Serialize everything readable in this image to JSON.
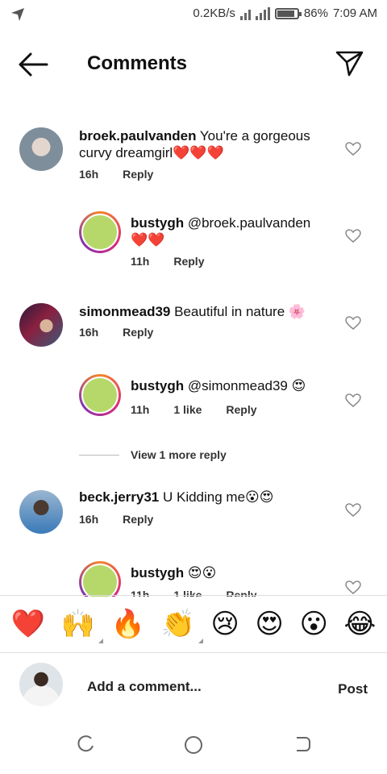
{
  "status": {
    "speed": "0.2KB/s",
    "battery": "86%",
    "battery_level": 0.86,
    "time": "7:09 AM"
  },
  "header": {
    "title": "Comments"
  },
  "comments": [
    {
      "user": "broek.paulvanden",
      "text": "You're a gorgeous curvy dreamgirl❤️❤️❤️",
      "time": "16h",
      "likes": "",
      "reply": "Reply"
    },
    {
      "user": "bustygh",
      "text": "@broek.paulvanden ❤️❤️",
      "time": "11h",
      "likes": "",
      "reply": "Reply"
    },
    {
      "user": "simonmead39",
      "text": "Beautiful in nature 🌸",
      "time": "16h",
      "likes": "",
      "reply": "Reply"
    },
    {
      "user": "bustygh",
      "text": "@simonmead39 😍",
      "time": "11h",
      "likes": "1 like",
      "reply": "Reply"
    },
    {
      "user": "beck.jerry31",
      "text": "U Kidding me😮😍",
      "time": "16h",
      "likes": "",
      "reply": "Reply"
    },
    {
      "user": "bustygh",
      "text": "😍😮",
      "time": "11h",
      "likes": "1 like",
      "reply": "Reply"
    }
  ],
  "view_more": "View 1 more reply",
  "emojis": [
    "❤️",
    "🙌",
    "🔥",
    "👏",
    "😢",
    "😍",
    "😮",
    "😂"
  ],
  "composer": {
    "placeholder": "Add a comment...",
    "post": "Post"
  },
  "colors": {
    "accent_ring": "#dd2a7b",
    "text": "#111111"
  },
  "icons": {
    "back": "back-arrow-icon",
    "send": "direct-send-icon",
    "heart": "heart-outline-icon"
  }
}
